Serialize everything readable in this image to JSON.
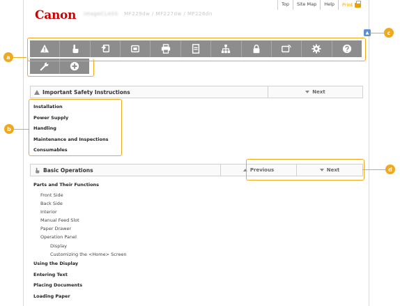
{
  "header": {
    "top_links": [
      "Top",
      "Site Map",
      "Help"
    ],
    "print_label": "Print",
    "logo": "Canon",
    "model_prefix": "imageCLASS",
    "model_suffix": "MF229dw / MF227dw / MF226dn"
  },
  "nav_icons": {
    "row1": [
      "warning-icon",
      "hand-icon",
      "copy-icon",
      "fax-icon",
      "print-icon",
      "scan-icon",
      "network-icon",
      "security-icon",
      "remote-ui-icon",
      "settings-icon",
      "help-icon"
    ],
    "row2": [
      "wrench-icon",
      "plus-icon"
    ]
  },
  "callouts": {
    "a": "a",
    "b": "b",
    "c": "c",
    "d": "d"
  },
  "section1": {
    "title": "Important Safety Instructions",
    "next_label": "Next",
    "items": [
      "Installation",
      "Power Supply",
      "Handling",
      "Maintenance and Inspections",
      "Consumables"
    ]
  },
  "section2": {
    "title": "Basic Operations",
    "previous_label": "Previous",
    "next_label": "Next"
  },
  "basic_list": [
    {
      "text": "Parts and Their Functions",
      "level": 0
    },
    {
      "text": "Front Side",
      "level": 1
    },
    {
      "text": "Back Side",
      "level": 1
    },
    {
      "text": "Interior",
      "level": 1
    },
    {
      "text": "Manual Feed Slot",
      "level": 1
    },
    {
      "text": "Paper Drawer",
      "level": 1
    },
    {
      "text": "Operation Panel",
      "level": 1
    },
    {
      "text": "Display",
      "level": 2
    },
    {
      "text": "Customizing the <Home> Screen",
      "level": 2
    },
    {
      "text": "Using the Display",
      "level": 0
    },
    {
      "text": "Entering Text",
      "level": 0
    },
    {
      "text": "Placing Documents",
      "level": 0
    },
    {
      "text": "Loading Paper",
      "level": 0
    }
  ],
  "colors": {
    "accent": "#f0a81c",
    "nav_bg": "#8d8d8d",
    "brand": "#cc0000"
  }
}
